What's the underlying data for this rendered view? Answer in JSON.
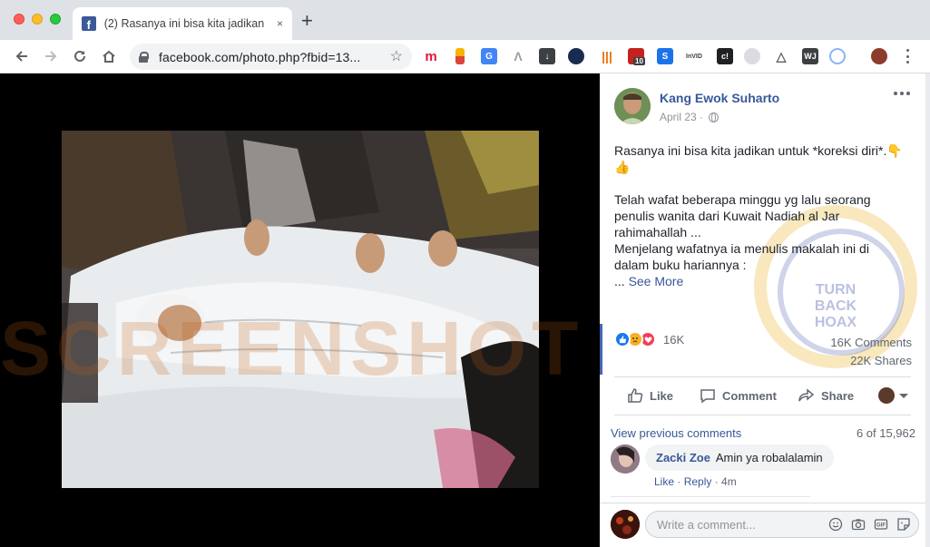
{
  "browser": {
    "tab_title": "(2) Rasanya ini bisa kita jadikan",
    "tab_close": "×",
    "new_tab": "+",
    "url": "facebook.com/photo.php?fbid=13...",
    "extension_badge": "10"
  },
  "watermarks": {
    "left_text": "SCREENSHOT",
    "right_text": "TURN BACK HOAX"
  },
  "post": {
    "author": "Kang Ewok Suharto",
    "date": "April 23 ·",
    "line1": "Rasanya ini bisa kita jadikan untuk *koreksi diri*.👇",
    "line2": "👍",
    "para2_l1": "Telah wafat beberapa minggu yg lalu seorang",
    "para2_l2": "penulis wanita dari Kuwait Nadiah al Jar",
    "para2_l3": "rahimahallah ...",
    "para3_l1": "Menjelang wafatnya ia menulis makalah ini di",
    "para3_l2": "dalam buku hariannya :",
    "ellipsis": "... ",
    "see_more": "See More"
  },
  "stats": {
    "reaction_count": "16K",
    "comments": "16K Comments",
    "shares": "22K Shares"
  },
  "actions": {
    "like": "Like",
    "comment": "Comment",
    "share": "Share"
  },
  "comments": {
    "view_previous": "View previous comments",
    "count": "6 of 15,962",
    "items": [
      {
        "name": "Zacki Zoe",
        "text": "Amin ya robalalamin",
        "like": "Like",
        "sep": " · ",
        "reply": "Reply",
        "time": " · 4m"
      }
    ],
    "write_placeholder": "Write a comment..."
  },
  "colors": {
    "facebook_blue": "#385898",
    "like_blue": "#1877f2",
    "text_dark": "#1d2129",
    "meta_gray": "#606770"
  }
}
